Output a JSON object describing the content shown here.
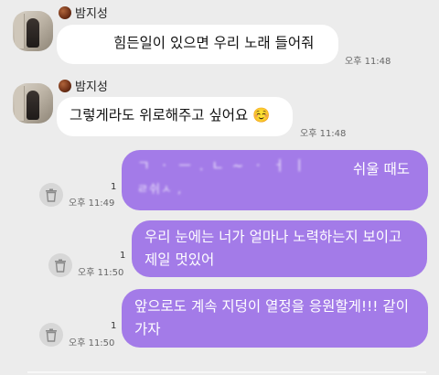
{
  "messages": {
    "m1": {
      "sender": "밤지성",
      "text": "힘든일이 있으면 우리 노래 들어줘",
      "time": "오후 11:48"
    },
    "m2": {
      "sender": "밤지성",
      "text": "그렇게라도 위로해주고 싶어요",
      "emoji": "☺️",
      "time": "오후 11:48"
    },
    "m3": {
      "text_visible": "쉬울 때도",
      "time": "오후 11:49",
      "unread": "1"
    },
    "m4": {
      "line1": "우리 눈에는 너가 얼마나 노력하는지 보이고",
      "line2": "제일 멋있어",
      "time": "오후 11:50",
      "unread": "1"
    },
    "m5": {
      "line1": "앞으로도 계속 지덩이 열정을 응원할게!!! 같이",
      "line2": "가자",
      "time": "오후 11:50",
      "unread": "1"
    }
  },
  "colors": {
    "background": "#ececec",
    "incoming": "#ffffff",
    "outgoing": "#a37be8"
  },
  "icons": {
    "sender": "chestnut-icon",
    "delete": "trash-icon"
  }
}
